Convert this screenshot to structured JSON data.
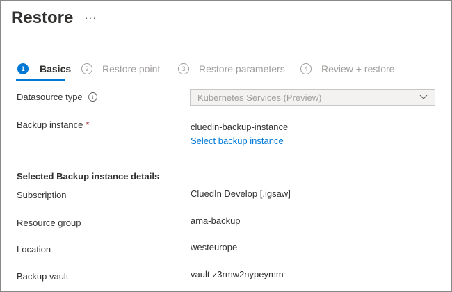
{
  "header": {
    "title": "Restore",
    "more_label": "···"
  },
  "wizard": {
    "steps": [
      {
        "number": "1",
        "label": "Basics",
        "active": true
      },
      {
        "number": "2",
        "label": "Restore point",
        "active": false
      },
      {
        "number": "3",
        "label": "Restore parameters",
        "active": false
      },
      {
        "number": "4",
        "label": "Review + restore",
        "active": false
      }
    ]
  },
  "form": {
    "datasource_type": {
      "label": "Datasource type",
      "info_icon": "i",
      "value": "Kubernetes Services (Preview)"
    },
    "backup_instance": {
      "label": "Backup instance",
      "required_mark": "*",
      "value": "cluedin-backup-instance",
      "link": "Select backup instance"
    }
  },
  "details": {
    "section_title": "Selected Backup instance details",
    "rows": [
      {
        "label": "Subscription",
        "value": "CluedIn Develop [.igsaw]"
      },
      {
        "label": "Resource group",
        "value": "ama-backup"
      },
      {
        "label": "Location",
        "value": "westeurope"
      },
      {
        "label": "Backup vault",
        "value": "vault-z3rmw2nypeymm"
      }
    ]
  },
  "colors": {
    "accent": "#0078d4",
    "required": "#a4262c",
    "disabled_text": "#a19f9d"
  }
}
